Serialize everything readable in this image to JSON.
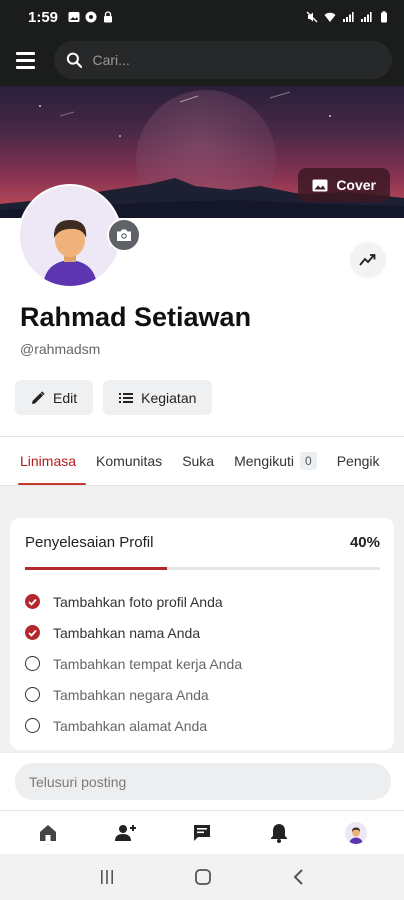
{
  "status_bar": {
    "time": "1:59"
  },
  "header": {
    "search_placeholder": "Cari..."
  },
  "cover": {
    "button_label": "Cover"
  },
  "profile": {
    "name": "Rahmad Setiawan",
    "username": "@rahmadsm",
    "edit_label": "Edit",
    "activity_label": "Kegiatan"
  },
  "tabs": [
    {
      "label": "Linimasa",
      "active": true
    },
    {
      "label": "Komunitas"
    },
    {
      "label": "Suka"
    },
    {
      "label": "Mengikuti",
      "count": "0"
    },
    {
      "label": "Pengik"
    }
  ],
  "completion": {
    "title": "Penyelesaian Profil",
    "percent_label": "40%",
    "progress": 0.4,
    "tasks": [
      {
        "label": "Tambahkan foto profil Anda",
        "done": true
      },
      {
        "label": "Tambahkan nama Anda",
        "done": true
      },
      {
        "label": "Tambahkan tempat kerja Anda",
        "done": false
      },
      {
        "label": "Tambahkan negara Anda",
        "done": false
      },
      {
        "label": "Tambahkan alamat Anda",
        "done": false
      }
    ]
  },
  "post_search": {
    "placeholder": "Telusuri posting"
  },
  "bottom_nav": [
    "home-icon",
    "add-friend-icon",
    "messages-icon",
    "notifications-icon",
    "profile-avatar"
  ],
  "colors": {
    "accent": "#b3282d",
    "header_bg": "#1b1c1c"
  }
}
